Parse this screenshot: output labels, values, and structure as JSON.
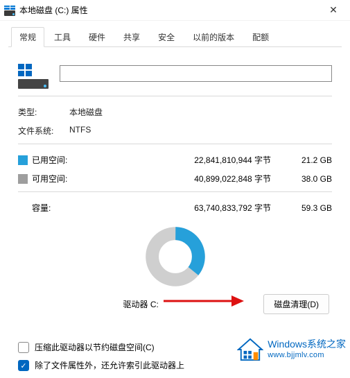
{
  "window": {
    "title": "本地磁盘 (C:) 属性",
    "close": "✕"
  },
  "tabs": [
    {
      "label": "常规",
      "active": true
    },
    {
      "label": "工具",
      "active": false
    },
    {
      "label": "硬件",
      "active": false
    },
    {
      "label": "共享",
      "active": false
    },
    {
      "label": "安全",
      "active": false
    },
    {
      "label": "以前的版本",
      "active": false
    },
    {
      "label": "配额",
      "active": false
    }
  ],
  "volume_name": {
    "value": "",
    "placeholder": ""
  },
  "type": {
    "label": "类型:",
    "value": "本地磁盘"
  },
  "fs": {
    "label": "文件系统:",
    "value": "NTFS"
  },
  "used": {
    "label": "已用空间:",
    "bytes": "22,841,810,944 字节",
    "gb": "21.2 GB",
    "color": "#26a0da"
  },
  "free": {
    "label": "可用空间:",
    "bytes": "40,899,022,848 字节",
    "gb": "38.0 GB",
    "color": "#9e9e9e"
  },
  "capacity": {
    "label": "容量:",
    "bytes": "63,740,833,792 字节",
    "gb": "59.3 GB"
  },
  "chart_caption": "驱动器 C:",
  "cleanup_button": "磁盘清理(D)",
  "compress": {
    "checked": false,
    "label": "压缩此驱动器以节约磁盘空间(C)"
  },
  "index": {
    "checked": true,
    "label": "除了文件属性外，还允许索引此驱动器上"
  },
  "chart_data": {
    "type": "pie",
    "title": "驱动器 C:",
    "series": [
      {
        "name": "已用空间",
        "value": 22841810944,
        "gb": 21.2,
        "color": "#26a0da"
      },
      {
        "name": "可用空间",
        "value": 40899022848,
        "gb": 38.0,
        "color": "#cfcfcf"
      }
    ],
    "total": 63740833792
  },
  "watermark": {
    "line1": "Windows系统之家",
    "line2": "www.bjjmlv.com"
  }
}
